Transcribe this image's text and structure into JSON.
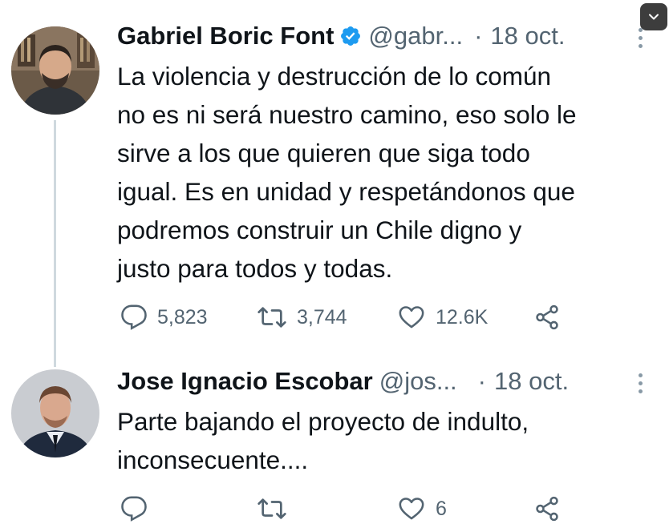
{
  "tweets": [
    {
      "name": "Gabriel Boric Font",
      "verified": true,
      "handle": "@gabr...",
      "dot": "·",
      "date": "18 oct.",
      "text": "La violencia y destrucción de lo común\nno es ni será nuestro camino, eso solo le\nsirve a los que quieren que siga todo\nigual. Es en unidad y respetándonos que\npodremos construir un Chile digno y\njusto para todos y todas.",
      "replies": "5,823",
      "retweets": "3,744",
      "likes": "12.6K"
    },
    {
      "name": "Jose Ignacio Escobar",
      "verified": false,
      "handle": "@jos...",
      "dot": "·",
      "date": "18 oct.",
      "text": "Parte bajando el proyecto de indulto,\ninconsecuente....",
      "replies": "",
      "retweets": "",
      "likes": "6"
    }
  ],
  "icons": {
    "reply": "reply-icon",
    "retweet": "retweet-icon",
    "like": "heart-icon",
    "share": "share-icon",
    "more": "more-options-icon",
    "verified": "verified-badge-icon",
    "corner": "chevron-down-icon"
  },
  "colors": {
    "verified_blue": "#1d9bf0",
    "secondary_text": "#536471",
    "primary_text": "#0f1419",
    "thread_line": "#cfd9de"
  }
}
